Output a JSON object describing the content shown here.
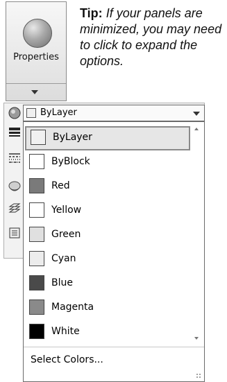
{
  "ribbon": {
    "properties_label": "Properties"
  },
  "tip": {
    "lead": "Tip:",
    "body": "If your panels are minimized, you may need to click to expand the options."
  },
  "combo": {
    "value": "ByLayer",
    "swatch_color": "#f0f0f0"
  },
  "colors": [
    {
      "label": "ByLayer",
      "color": "#f0f0f0",
      "selected": true
    },
    {
      "label": "ByBlock",
      "color": "#ffffff",
      "selected": false
    },
    {
      "label": "Red",
      "color": "#7a7a7a",
      "selected": false
    },
    {
      "label": "Yellow",
      "color": "#ffffff",
      "selected": false
    },
    {
      "label": "Green",
      "color": "#e0e0e0",
      "selected": false
    },
    {
      "label": "Cyan",
      "color": "#ececec",
      "selected": false
    },
    {
      "label": "Blue",
      "color": "#4a4a4a",
      "selected": false
    },
    {
      "label": "Magenta",
      "color": "#8a8a8a",
      "selected": false
    },
    {
      "label": "White",
      "color": "#000000",
      "selected": false
    }
  ],
  "footer": {
    "select_colors": "Select Colors..."
  },
  "toolbar_icons": [
    "color-wheel-icon",
    "lineweight-icon",
    "linetype-icon",
    "transparency-icon",
    "layer-stack-icon",
    "list-icon"
  ]
}
